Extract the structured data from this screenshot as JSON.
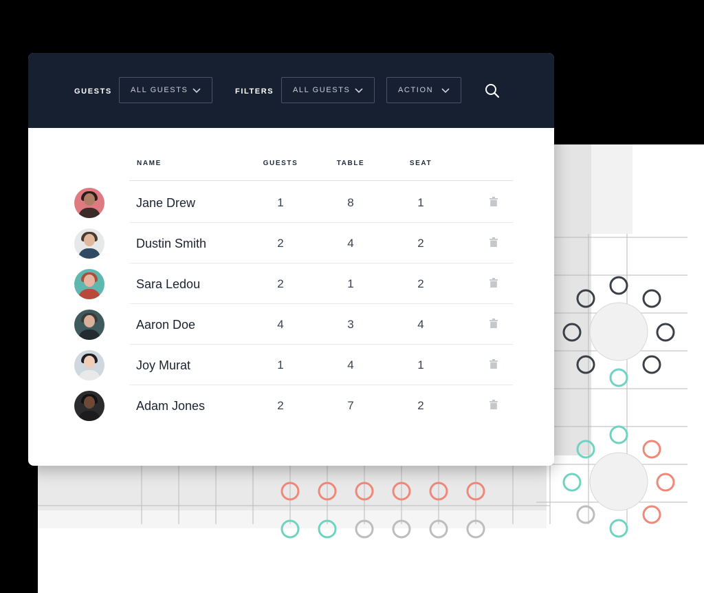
{
  "toolbar": {
    "guests_label": "GUESTS",
    "guests_select": "ALL GUESTS",
    "filters_label": "FILTERS",
    "filters_select": "ALL GUESTS",
    "action_select": "ACTION",
    "search_icon": "search-icon",
    "chevron_icon": "chevron-down-icon"
  },
  "table": {
    "columns": [
      "NAME",
      "GUESTS",
      "TABLE",
      "SEAT"
    ],
    "rows": [
      {
        "name": "Jane Drew",
        "guests": "1",
        "table": "8",
        "seat": "1"
      },
      {
        "name": "Dustin Smith",
        "guests": "2",
        "table": "4",
        "seat": "2"
      },
      {
        "name": "Sara Ledou",
        "guests": "2",
        "table": "1",
        "seat": "2"
      },
      {
        "name": "Aaron Doe",
        "guests": "4",
        "table": "3",
        "seat": "4"
      },
      {
        "name": "Joy Murat",
        "guests": "1",
        "table": "4",
        "seat": "1"
      },
      {
        "name": "Adam Jones",
        "guests": "2",
        "table": "7",
        "seat": "2"
      }
    ],
    "row_action_icon": "trash-icon"
  },
  "colors": {
    "toolbar_bg": "#172031",
    "seat_dark": "#3b4048",
    "seat_teal": "#6ed3c0",
    "seat_coral": "#f0887a",
    "seat_grey": "#bdbdbd",
    "table_fill": "#f1f1f1"
  }
}
